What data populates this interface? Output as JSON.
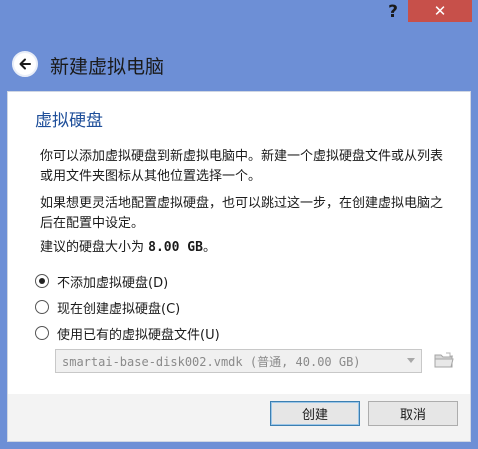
{
  "titlebar": {
    "help_label": "?",
    "close_label": "✕"
  },
  "header": {
    "title": "新建虚拟电脑",
    "back_icon": "back-arrow-icon"
  },
  "page": {
    "heading": "虚拟硬盘",
    "paragraph1": "你可以添加虚拟硬盘到新虚拟电脑中。新建一个虚拟硬盘文件或从列表或用文件夹图标从其他位置选择一个。",
    "paragraph2": "如果想更灵活地配置虚拟硬盘，也可以跳过这一步，在创建虚拟电脑之后在配置中设定。",
    "recommend_prefix": "建议的硬盘大小为 ",
    "recommend_size": "8.00 GB",
    "recommend_suffix": "。"
  },
  "options": [
    {
      "label": "不添加虚拟硬盘(D)",
      "checked": true
    },
    {
      "label": "现在创建虚拟硬盘(C)",
      "checked": false
    },
    {
      "label": "使用已有的虚拟硬盘文件(U)",
      "checked": false
    }
  ],
  "disk_select": {
    "value": "smartai-base-disk002.vmdk (普通, 40.00 GB)"
  },
  "buttons": {
    "create": "创建",
    "cancel": "取消"
  },
  "colors": {
    "window_frame": "#6d8fd6",
    "close_button": "#c7504a",
    "heading": "#1f4f9a"
  }
}
